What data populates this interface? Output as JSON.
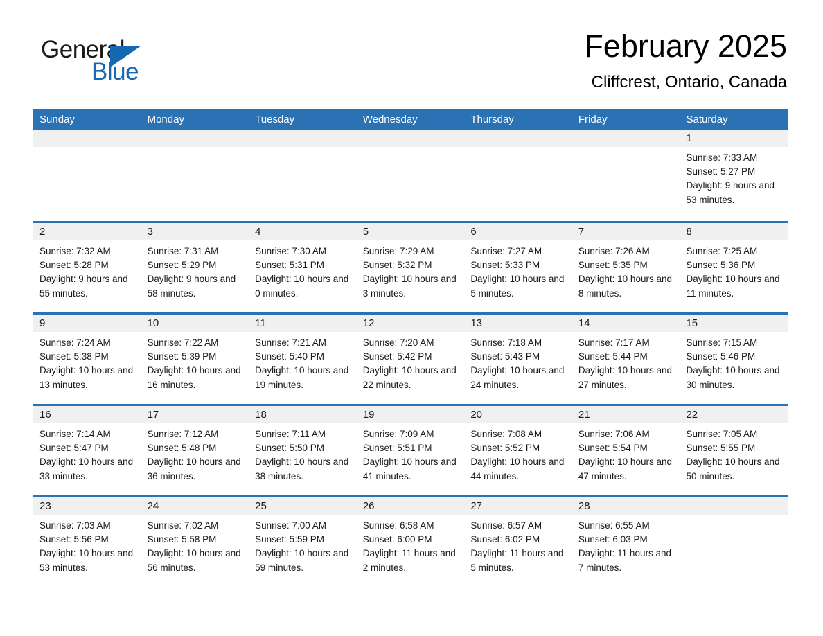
{
  "brand": {
    "logo_text_1": "General",
    "logo_text_2": "Blue",
    "accent_color": "#1668b3",
    "header_bar_color": "#2B72B4",
    "daynum_band_color": "#F0F0F0"
  },
  "header": {
    "title": "February 2025",
    "location": "Cliffcrest, Ontario, Canada"
  },
  "weekdays": [
    "Sunday",
    "Monday",
    "Tuesday",
    "Wednesday",
    "Thursday",
    "Friday",
    "Saturday"
  ],
  "labels": {
    "sunrise_prefix": "Sunrise:",
    "sunset_prefix": "Sunset:",
    "daylight_prefix": "Daylight:"
  },
  "weeks": [
    [
      {
        "empty": true
      },
      {
        "empty": true
      },
      {
        "empty": true
      },
      {
        "empty": true
      },
      {
        "empty": true
      },
      {
        "empty": true
      },
      {
        "day": "1",
        "sunrise": "Sunrise: 7:33 AM",
        "sunset": "Sunset: 5:27 PM",
        "daylight": "Daylight: 9 hours and 53 minutes."
      }
    ],
    [
      {
        "day": "2",
        "sunrise": "Sunrise: 7:32 AM",
        "sunset": "Sunset: 5:28 PM",
        "daylight": "Daylight: 9 hours and 55 minutes."
      },
      {
        "day": "3",
        "sunrise": "Sunrise: 7:31 AM",
        "sunset": "Sunset: 5:29 PM",
        "daylight": "Daylight: 9 hours and 58 minutes."
      },
      {
        "day": "4",
        "sunrise": "Sunrise: 7:30 AM",
        "sunset": "Sunset: 5:31 PM",
        "daylight": "Daylight: 10 hours and 0 minutes."
      },
      {
        "day": "5",
        "sunrise": "Sunrise: 7:29 AM",
        "sunset": "Sunset: 5:32 PM",
        "daylight": "Daylight: 10 hours and 3 minutes."
      },
      {
        "day": "6",
        "sunrise": "Sunrise: 7:27 AM",
        "sunset": "Sunset: 5:33 PM",
        "daylight": "Daylight: 10 hours and 5 minutes."
      },
      {
        "day": "7",
        "sunrise": "Sunrise: 7:26 AM",
        "sunset": "Sunset: 5:35 PM",
        "daylight": "Daylight: 10 hours and 8 minutes."
      },
      {
        "day": "8",
        "sunrise": "Sunrise: 7:25 AM",
        "sunset": "Sunset: 5:36 PM",
        "daylight": "Daylight: 10 hours and 11 minutes."
      }
    ],
    [
      {
        "day": "9",
        "sunrise": "Sunrise: 7:24 AM",
        "sunset": "Sunset: 5:38 PM",
        "daylight": "Daylight: 10 hours and 13 minutes."
      },
      {
        "day": "10",
        "sunrise": "Sunrise: 7:22 AM",
        "sunset": "Sunset: 5:39 PM",
        "daylight": "Daylight: 10 hours and 16 minutes."
      },
      {
        "day": "11",
        "sunrise": "Sunrise: 7:21 AM",
        "sunset": "Sunset: 5:40 PM",
        "daylight": "Daylight: 10 hours and 19 minutes."
      },
      {
        "day": "12",
        "sunrise": "Sunrise: 7:20 AM",
        "sunset": "Sunset: 5:42 PM",
        "daylight": "Daylight: 10 hours and 22 minutes."
      },
      {
        "day": "13",
        "sunrise": "Sunrise: 7:18 AM",
        "sunset": "Sunset: 5:43 PM",
        "daylight": "Daylight: 10 hours and 24 minutes."
      },
      {
        "day": "14",
        "sunrise": "Sunrise: 7:17 AM",
        "sunset": "Sunset: 5:44 PM",
        "daylight": "Daylight: 10 hours and 27 minutes."
      },
      {
        "day": "15",
        "sunrise": "Sunrise: 7:15 AM",
        "sunset": "Sunset: 5:46 PM",
        "daylight": "Daylight: 10 hours and 30 minutes."
      }
    ],
    [
      {
        "day": "16",
        "sunrise": "Sunrise: 7:14 AM",
        "sunset": "Sunset: 5:47 PM",
        "daylight": "Daylight: 10 hours and 33 minutes."
      },
      {
        "day": "17",
        "sunrise": "Sunrise: 7:12 AM",
        "sunset": "Sunset: 5:48 PM",
        "daylight": "Daylight: 10 hours and 36 minutes."
      },
      {
        "day": "18",
        "sunrise": "Sunrise: 7:11 AM",
        "sunset": "Sunset: 5:50 PM",
        "daylight": "Daylight: 10 hours and 38 minutes."
      },
      {
        "day": "19",
        "sunrise": "Sunrise: 7:09 AM",
        "sunset": "Sunset: 5:51 PM",
        "daylight": "Daylight: 10 hours and 41 minutes."
      },
      {
        "day": "20",
        "sunrise": "Sunrise: 7:08 AM",
        "sunset": "Sunset: 5:52 PM",
        "daylight": "Daylight: 10 hours and 44 minutes."
      },
      {
        "day": "21",
        "sunrise": "Sunrise: 7:06 AM",
        "sunset": "Sunset: 5:54 PM",
        "daylight": "Daylight: 10 hours and 47 minutes."
      },
      {
        "day": "22",
        "sunrise": "Sunrise: 7:05 AM",
        "sunset": "Sunset: 5:55 PM",
        "daylight": "Daylight: 10 hours and 50 minutes."
      }
    ],
    [
      {
        "day": "23",
        "sunrise": "Sunrise: 7:03 AM",
        "sunset": "Sunset: 5:56 PM",
        "daylight": "Daylight: 10 hours and 53 minutes."
      },
      {
        "day": "24",
        "sunrise": "Sunrise: 7:02 AM",
        "sunset": "Sunset: 5:58 PM",
        "daylight": "Daylight: 10 hours and 56 minutes."
      },
      {
        "day": "25",
        "sunrise": "Sunrise: 7:00 AM",
        "sunset": "Sunset: 5:59 PM",
        "daylight": "Daylight: 10 hours and 59 minutes."
      },
      {
        "day": "26",
        "sunrise": "Sunrise: 6:58 AM",
        "sunset": "Sunset: 6:00 PM",
        "daylight": "Daylight: 11 hours and 2 minutes."
      },
      {
        "day": "27",
        "sunrise": "Sunrise: 6:57 AM",
        "sunset": "Sunset: 6:02 PM",
        "daylight": "Daylight: 11 hours and 5 minutes."
      },
      {
        "day": "28",
        "sunrise": "Sunrise: 6:55 AM",
        "sunset": "Sunset: 6:03 PM",
        "daylight": "Daylight: 11 hours and 7 minutes."
      },
      {
        "empty": true
      }
    ]
  ]
}
